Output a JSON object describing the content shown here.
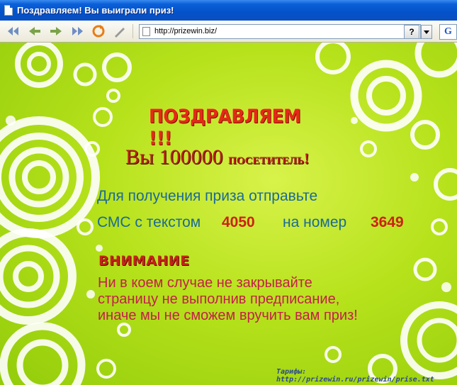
{
  "window": {
    "title": "Поздравляем! Вы выиграли приз!"
  },
  "toolbar": {
    "buttons": [
      "back-icon",
      "forward-icon",
      "forward-green-icon",
      "fast-forward-icon",
      "refresh-icon",
      "edit-icon"
    ],
    "address": "http://prizewin.biz/",
    "help_label": "?",
    "google_label": "G"
  },
  "page": {
    "heading": "ПОЗДРАВЛЯЕМ !!!",
    "visitor_prefix": "Вы 100000 ",
    "visitor_suffix": "посетитель!",
    "instruction_line1": "Для получения приза отправьте",
    "instruction_line2": "СМС с текстом",
    "sms_code": "4050",
    "to_number_label": "на номер",
    "short_number": "3649",
    "warning_title": "ВНИМАНИЕ",
    "warning_line1": "Ни в коем случае не закрывайте",
    "warning_line2": "страницу не выполнив предписание,",
    "warning_line3": "иначе мы не сможем вручить вам приз!",
    "footer": "Тарифы:  http://prizewin.ru/prizewin/prise.txt"
  },
  "colors": {
    "background": "#b6e21b",
    "heading": "#e32a18",
    "instruction": "#1c6a96",
    "warning": "#c41f4a"
  }
}
